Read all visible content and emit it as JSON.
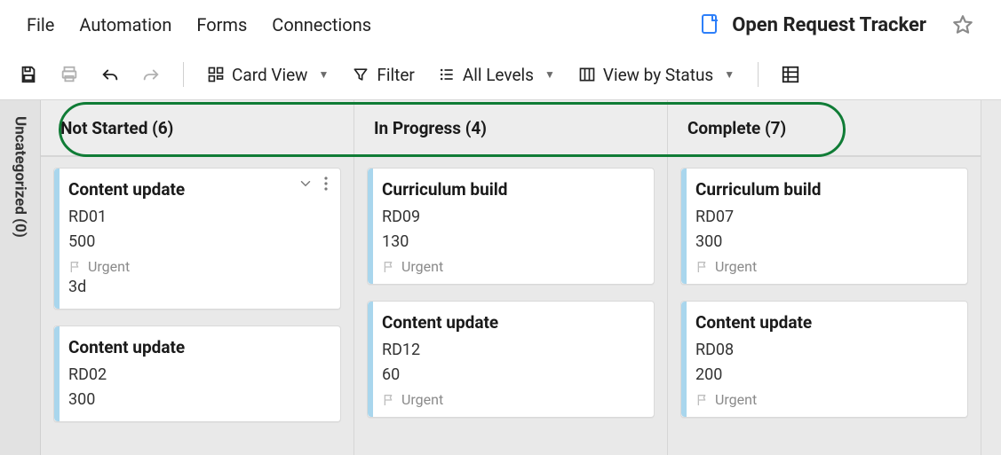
{
  "menubar": {
    "file": "File",
    "automation": "Automation",
    "forms": "Forms",
    "connections": "Connections"
  },
  "doc": {
    "title": "Open Request Tracker"
  },
  "toolbar": {
    "cardview_label": "Card View",
    "filter_label": "Filter",
    "levels_label": "All Levels",
    "viewby_label": "View by Status"
  },
  "uncategorized": {
    "label": "Uncategorized (0)"
  },
  "columns": [
    {
      "header": "Not Started (6)",
      "cards": [
        {
          "title": "Content update",
          "id": "RD01",
          "num": "500",
          "flag": "Urgent",
          "extra": "3d",
          "show_controls": true
        },
        {
          "title": "Content update",
          "id": "RD02",
          "num": "300"
        }
      ]
    },
    {
      "header": "In Progress (4)",
      "cards": [
        {
          "title": "Curriculum build",
          "id": "RD09",
          "num": "130",
          "flag": "Urgent"
        },
        {
          "title": "Content update",
          "id": "RD12",
          "num": "60",
          "flag": "Urgent"
        }
      ]
    },
    {
      "header": "Complete (7)",
      "cards": [
        {
          "title": "Curriculum build",
          "id": "RD07",
          "num": "300",
          "flag": "Urgent"
        },
        {
          "title": "Content update",
          "id": "RD08",
          "num": "200",
          "flag": "Urgent"
        }
      ]
    }
  ]
}
